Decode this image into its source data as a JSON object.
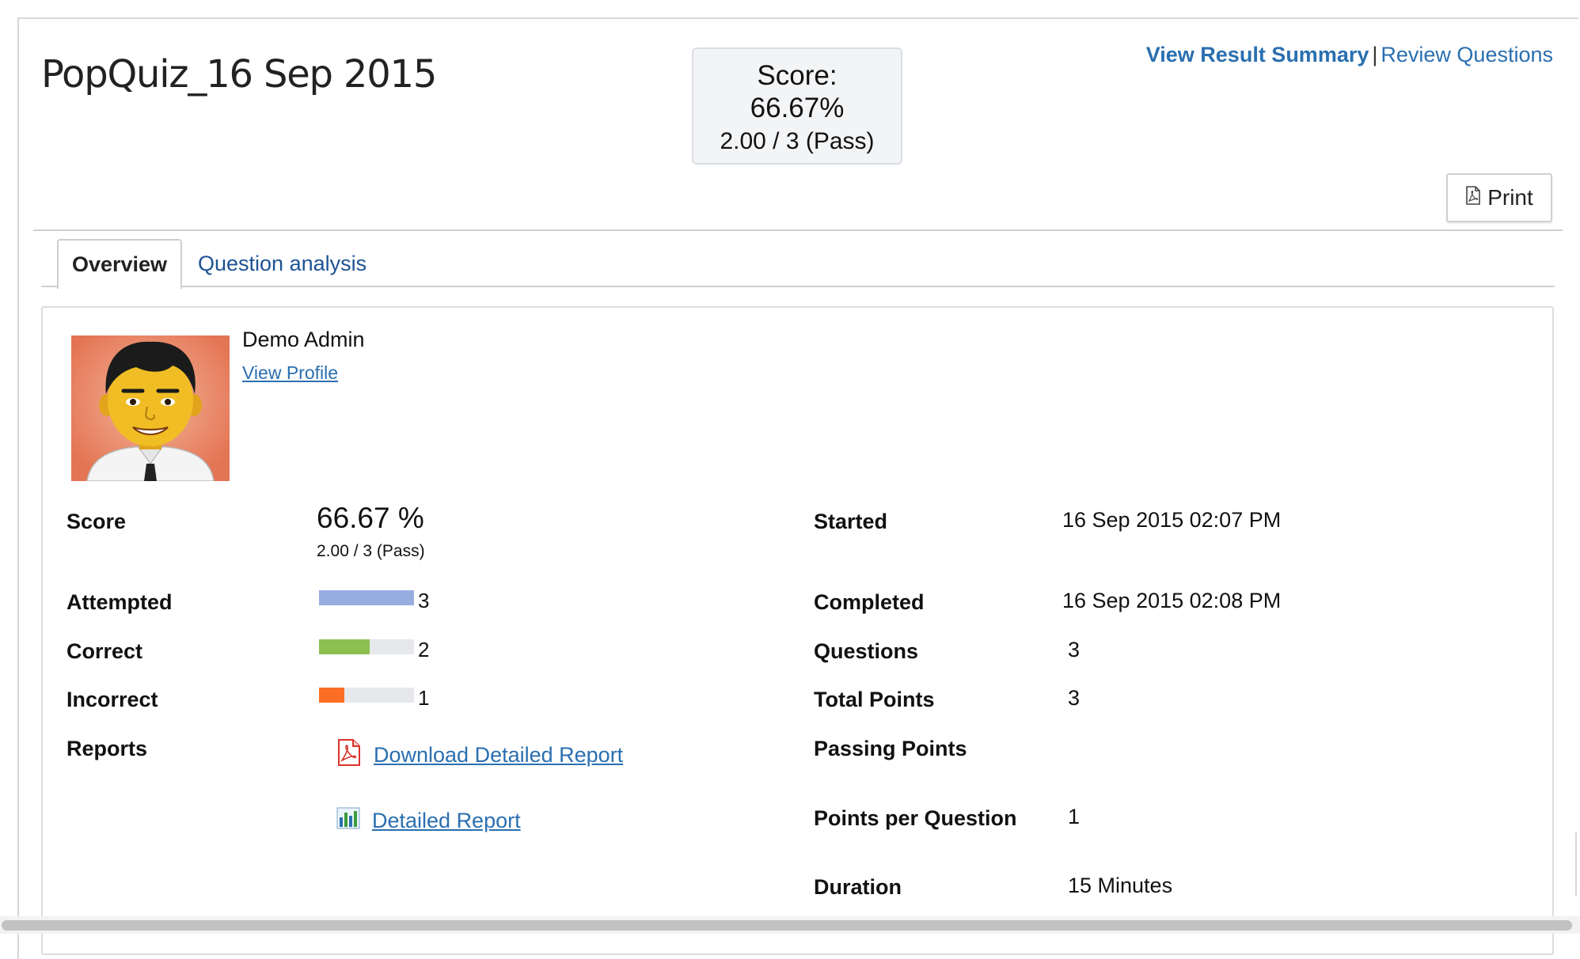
{
  "header": {
    "quiz_title": "PopQuiz_16 Sep 2015",
    "score_box": {
      "label": "Score:",
      "percent": "66.67%",
      "detail": "2.00 / 3 (Pass)"
    },
    "links": {
      "result_summary": "View Result Summary",
      "separator": "|",
      "review_questions": "Review Questions"
    },
    "print_label": "Print"
  },
  "tabs": [
    {
      "label": "Overview",
      "active": true
    },
    {
      "label": "Question analysis",
      "active": false
    }
  ],
  "user": {
    "name": "Demo Admin",
    "profile_link": "View Profile"
  },
  "left_stats": {
    "score_label": "Score",
    "score_percent": "66.67 %",
    "score_detail": "2.00 / 3 (Pass)",
    "attempted_label": "Attempted",
    "attempted": {
      "value": "3",
      "fraction": 1.0,
      "color": "#97ade0"
    },
    "correct_label": "Correct",
    "correct": {
      "value": "2",
      "fraction": 0.5333,
      "color": "#8cc152"
    },
    "incorrect_label": "Incorrect",
    "incorrect": {
      "value": "1",
      "fraction": 0.2667,
      "color": "#fc6e25"
    },
    "reports_label": "Reports",
    "download_report": "Download Detailed Report",
    "detailed_report": "Detailed Report"
  },
  "right_stats": {
    "started_label": "Started",
    "started": "16 Sep 2015 02:07 PM",
    "completed_label": "Completed",
    "completed": "16 Sep 2015 02:08 PM",
    "questions_label": "Questions",
    "questions": "3",
    "total_points_label": "Total Points",
    "total_points": "3",
    "passing_points_label": "Passing Points",
    "passing_points": "",
    "points_per_question_label": "Points per Question",
    "points_per_question": "1",
    "duration_label": "Duration",
    "duration": "15 Minutes"
  },
  "colors": {
    "link": "#2a6fb0",
    "tab_link": "#1d5394",
    "pdf_red": "#d9332a"
  },
  "icons": {
    "print": "pdf-icon",
    "download": "pdf-file-icon",
    "report": "bar-chart-icon"
  }
}
